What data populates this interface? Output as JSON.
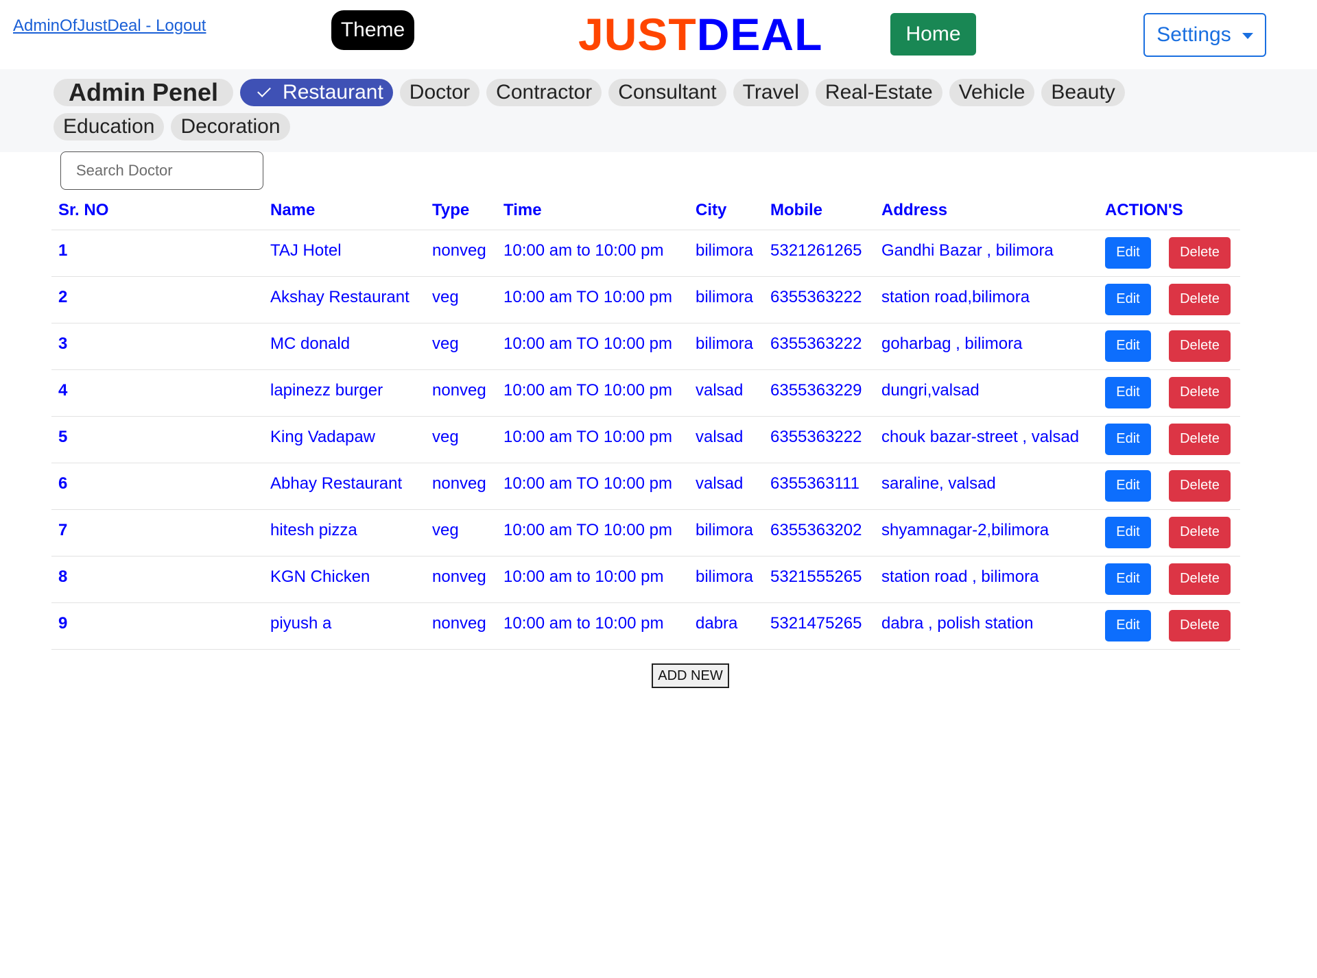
{
  "header": {
    "logout_link": "AdminOfJustDeal - Logout",
    "theme_label": "Theme",
    "brand_part1": "JUST",
    "brand_part2": "DEAL",
    "home_label": "Home",
    "settings_label": "Settings",
    "colors": {
      "brand_orange": "#ff4500",
      "brand_blue": "#0000ff",
      "home": "#198754",
      "settings": "#1a6fe0"
    }
  },
  "categories": {
    "admin_label": "Admin Penel",
    "active": "Restaurant",
    "items": [
      "Restaurant",
      "Doctor",
      "Contractor",
      "Consultant",
      "Travel",
      "Real-Estate",
      "Vehicle",
      "Beauty",
      "Education",
      "Decoration"
    ]
  },
  "search": {
    "placeholder": "Search Doctor",
    "value": ""
  },
  "table": {
    "headers": [
      "Sr. NO",
      "Name",
      "Type",
      "Time",
      "City",
      "Mobile",
      "Address",
      "ACTION'S"
    ],
    "edit_label": "Edit",
    "delete_label": "Delete",
    "rows": [
      {
        "sr": "1",
        "name": "TAJ Hotel",
        "type": "nonveg",
        "time": "10:00 am to 10:00 pm",
        "city": "bilimora",
        "mobile": "5321261265",
        "address": "Gandhi Bazar , bilimora"
      },
      {
        "sr": "2",
        "name": "Akshay Restaurant",
        "type": "veg",
        "time": "10:00 am TO 10:00 pm",
        "city": "bilimora",
        "mobile": "6355363222",
        "address": "station road,bilimora"
      },
      {
        "sr": "3",
        "name": "MC donald",
        "type": "veg",
        "time": "10:00 am TO 10:00 pm",
        "city": "bilimora",
        "mobile": "6355363222",
        "address": "goharbag , bilimora"
      },
      {
        "sr": "4",
        "name": "lapinezz burger",
        "type": "nonveg",
        "time": "10:00 am TO 10:00 pm",
        "city": "valsad",
        "mobile": "6355363229",
        "address": "dungri,valsad"
      },
      {
        "sr": "5",
        "name": "King Vadapaw",
        "type": "veg",
        "time": "10:00 am TO 10:00 pm",
        "city": "valsad",
        "mobile": "6355363222",
        "address": "chouk bazar-street , valsad"
      },
      {
        "sr": "6",
        "name": "Abhay Restaurant",
        "type": "nonveg",
        "time": "10:00 am TO 10:00 pm",
        "city": "valsad",
        "mobile": "6355363111",
        "address": "saraline, valsad"
      },
      {
        "sr": "7",
        "name": "hitesh pizza",
        "type": "veg",
        "time": "10:00 am TO 10:00 pm",
        "city": "bilimora",
        "mobile": "6355363202",
        "address": "shyamnagar-2,bilimora"
      },
      {
        "sr": "8",
        "name": "KGN Chicken",
        "type": "nonveg",
        "time": "10:00 am to 10:00 pm",
        "city": "bilimora",
        "mobile": "5321555265",
        "address": "station road , bilimora"
      },
      {
        "sr": "9",
        "name": "piyush a",
        "type": "nonveg",
        "time": "10:00 am to 10:00 pm",
        "city": "dabra",
        "mobile": "5321475265",
        "address": "dabra , polish station"
      }
    ]
  },
  "add_new_label": "ADD NEW"
}
